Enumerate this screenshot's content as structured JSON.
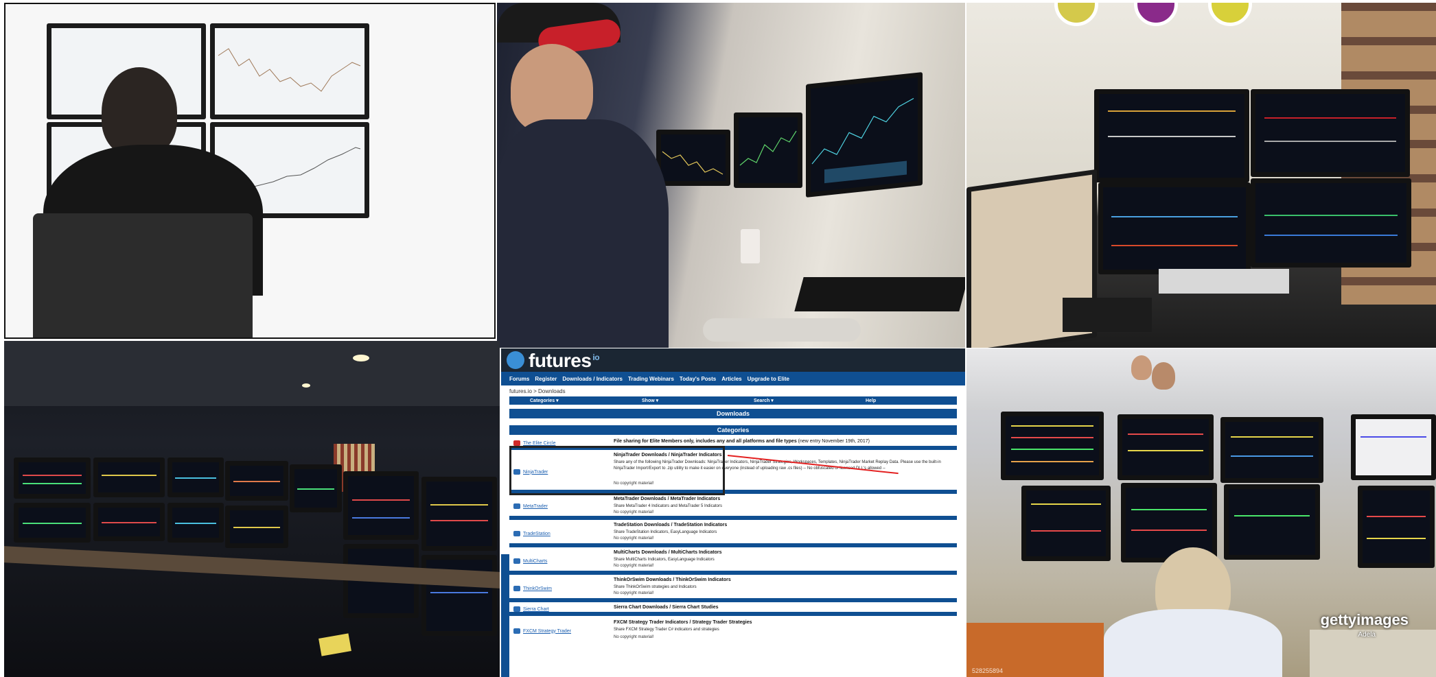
{
  "photos": {
    "p1": {
      "subject": "trader-four-monitors"
    },
    "p2": {
      "subject": "trader-cap-three-monitors"
    },
    "p3": {
      "subject": "home-office-multi-monitor"
    },
    "p4": {
      "subject": "dark-trading-room-desk"
    },
    "p6": {
      "subject": "trading-floor-bloomberg",
      "watermark": "gettyimages",
      "watermark_sub": "Adela",
      "photo_id": "528255894"
    }
  },
  "futures_page": {
    "brand": "futures",
    "brand_suffix": "io",
    "nav": [
      "Forums",
      "Register",
      "Downloads / Indicators",
      "Trading Webinars",
      "Today's Posts",
      "Articles",
      "Upgrade to Elite"
    ],
    "breadcrumb": "futures.io > Downloads",
    "filters": [
      "Categories ▾",
      "Show ▾",
      "Search ▾",
      "Help"
    ],
    "section_title": "Downloads",
    "categories_header": "Categories",
    "rows": [
      {
        "link": "The Elite Circle",
        "title": "File sharing for Elite Members only, includes any and all platforms and file types",
        "title_suffix": "(new entry November 19th, 2017)",
        "desc": "",
        "note": ""
      },
      {
        "link": "NinjaTrader",
        "title": "NinjaTrader Downloads / NinjaTrader Indicators",
        "desc": "Share any of the following NinjaTrader Downloads: NinjaTrader Indicators, NinjaTrader Strategies, Workspaces, Templates, NinjaTrader Market Replay Data. Please use the built-in NinjaTrader Import/Export to .zip utility to make it easier on everyone (instead of uploading raw .cs files) -- No obfuscated or licensed DLL's allowed --",
        "note": "No copyright material!"
      },
      {
        "link": "MetaTrader",
        "title": "MetaTrader Downloads / MetaTrader Indicators",
        "desc": "Share MetaTrader 4 Indicators and MetaTrader 5 Indicators",
        "note": "No copyright material!"
      },
      {
        "link": "TradeStation",
        "title": "TradeStation Downloads / TradeStation Indicators",
        "desc": "Share TradeStation Indicators, EasyLanguage Indicators",
        "note": "No copyright material!"
      },
      {
        "link": "MultiCharts",
        "title": "MultiCharts Downloads / MultiCharts Indicators",
        "desc": "Share MultiCharts Indicators, EasyLanguage Indicators",
        "note": "No copyright material!"
      },
      {
        "link": "ThinkOrSwim",
        "title": "ThinkOrSwim Downloads / ThinkOrSwim Indicators",
        "desc": "Share ThinkOrSwim strategies and Indicators",
        "note": "No copyright material!"
      },
      {
        "link": "Sierra Chart",
        "title": "Sierra Chart Downloads / Sierra Chart Studies",
        "desc": "",
        "note": ""
      },
      {
        "link": "FXCM Strategy Trader",
        "title": "FXCM Strategy Trader Indicators / Strategy Trader Strategies",
        "desc": "Share FXCM Strategy Trader C# indicators and strategies",
        "note": "No copyright material!"
      }
    ]
  },
  "colors": {
    "fio_blue": "#0f4f92",
    "fio_dark": "#1b2633",
    "highlight_arrow": "#e32020"
  }
}
